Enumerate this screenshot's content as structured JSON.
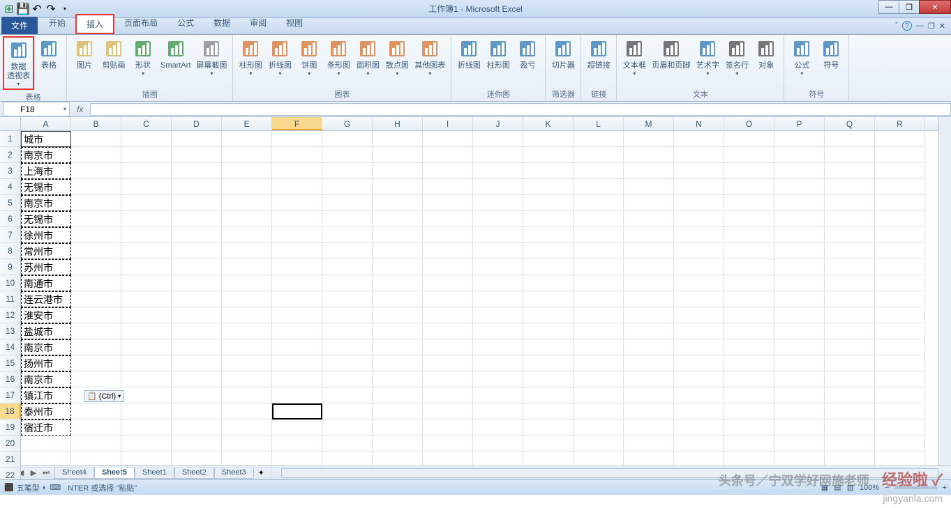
{
  "title": "工作簿1 - Microsoft Excel",
  "qat": {
    "save": "💾",
    "undo": "↶",
    "redo": "↷"
  },
  "tabs": {
    "file": "文件",
    "items": [
      "开始",
      "插入",
      "页面布局",
      "公式",
      "数据",
      "审阅",
      "视图"
    ],
    "active": 1
  },
  "ribbon": {
    "groups": [
      {
        "label": "表格",
        "items": [
          {
            "name": "数据透视表",
            "label": "数据\n透视表",
            "drop": "▾",
            "highlighted": true
          },
          {
            "name": "表格",
            "label": "表格"
          }
        ]
      },
      {
        "label": "插图",
        "items": [
          {
            "name": "图片",
            "label": "图片"
          },
          {
            "name": "剪贴画",
            "label": "剪贴画"
          },
          {
            "name": "形状",
            "label": "形状",
            "drop": "▾"
          },
          {
            "name": "SmartArt",
            "label": "SmartArt"
          },
          {
            "name": "屏幕截图",
            "label": "屏幕截图",
            "drop": "▾"
          }
        ]
      },
      {
        "label": "图表",
        "items": [
          {
            "name": "柱形图",
            "label": "柱形图",
            "drop": "▾"
          },
          {
            "name": "折线图",
            "label": "折线图",
            "drop": "▾"
          },
          {
            "name": "饼图",
            "label": "饼图",
            "drop": "▾"
          },
          {
            "name": "条形图",
            "label": "条形图",
            "drop": "▾"
          },
          {
            "name": "面积图",
            "label": "面积图",
            "drop": "▾"
          },
          {
            "name": "散点图",
            "label": "散点图",
            "drop": "▾"
          },
          {
            "name": "其他图表",
            "label": "其他图表",
            "drop": "▾"
          }
        ]
      },
      {
        "label": "迷你图",
        "items": [
          {
            "name": "折线图2",
            "label": "折线图"
          },
          {
            "name": "柱形图2",
            "label": "柱形图"
          },
          {
            "name": "盈亏",
            "label": "盈亏"
          }
        ]
      },
      {
        "label": "筛选器",
        "items": [
          {
            "name": "切片器",
            "label": "切片器"
          }
        ]
      },
      {
        "label": "链接",
        "items": [
          {
            "name": "超链接",
            "label": "超链接"
          }
        ]
      },
      {
        "label": "文本",
        "items": [
          {
            "name": "文本框",
            "label": "文本框",
            "drop": "▾"
          },
          {
            "name": "页眉和页脚",
            "label": "页眉和页脚"
          },
          {
            "name": "艺术字",
            "label": "艺术字",
            "drop": "▾"
          },
          {
            "name": "签名行",
            "label": "签名行",
            "drop": "▾"
          },
          {
            "name": "对象",
            "label": "对象"
          }
        ]
      },
      {
        "label": "符号",
        "items": [
          {
            "name": "公式",
            "label": "公式",
            "drop": "▾"
          },
          {
            "name": "符号",
            "label": "符号"
          }
        ]
      }
    ]
  },
  "namebox": "F18",
  "columns": [
    "A",
    "B",
    "C",
    "D",
    "E",
    "F",
    "G",
    "H",
    "I",
    "J",
    "K",
    "L",
    "M",
    "N",
    "O",
    "P",
    "Q",
    "R"
  ],
  "active_col": "F",
  "active_row": 18,
  "data_col_a": [
    "城市",
    "南京市",
    "上海市",
    "无锡市",
    "南京市",
    "无锡市",
    "徐州市",
    "常州市",
    "苏州市",
    "南通市",
    "连云港市",
    "淮安市",
    "盐城市",
    "南京市",
    "扬州市",
    "南京市",
    "镇江市",
    "泰州市",
    "宿迁市"
  ],
  "num_rows": 22,
  "paste_tag": "(Ctrl)",
  "sheets": [
    "Sheet4",
    "Sheet5",
    "Sheet1",
    "Sheet2",
    "Sheet3"
  ],
  "active_sheet": 1,
  "status": {
    "ime": "五笔型",
    "hint": "NTER 或选择 \"粘贴\"",
    "zoom": "100%"
  },
  "watermark1": "头条号／宁双学好网施老师",
  "watermark2": "经验啦 ✓",
  "watermark3": "jingyanla.com"
}
